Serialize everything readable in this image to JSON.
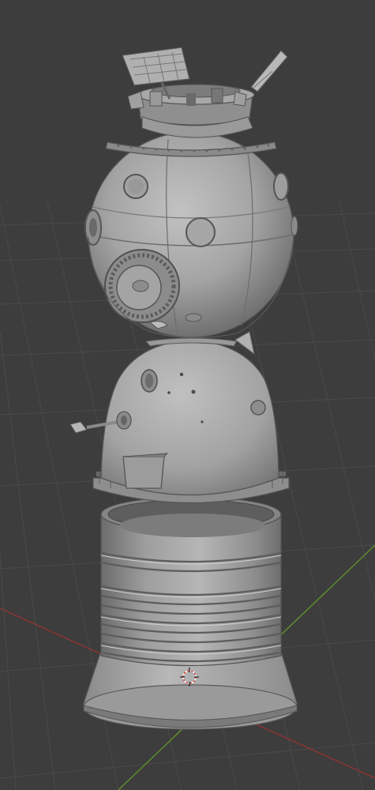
{
  "viewport": {
    "kind": "3d-viewport",
    "background_color": "#3d3d3d",
    "grid_color": "#4a4a4a",
    "x_axis_color": "#8a3434",
    "y_axis_color": "#5f8a2e",
    "model_color": "#a8a8a8",
    "origin_marker_icon": "3d-cursor-icon"
  }
}
